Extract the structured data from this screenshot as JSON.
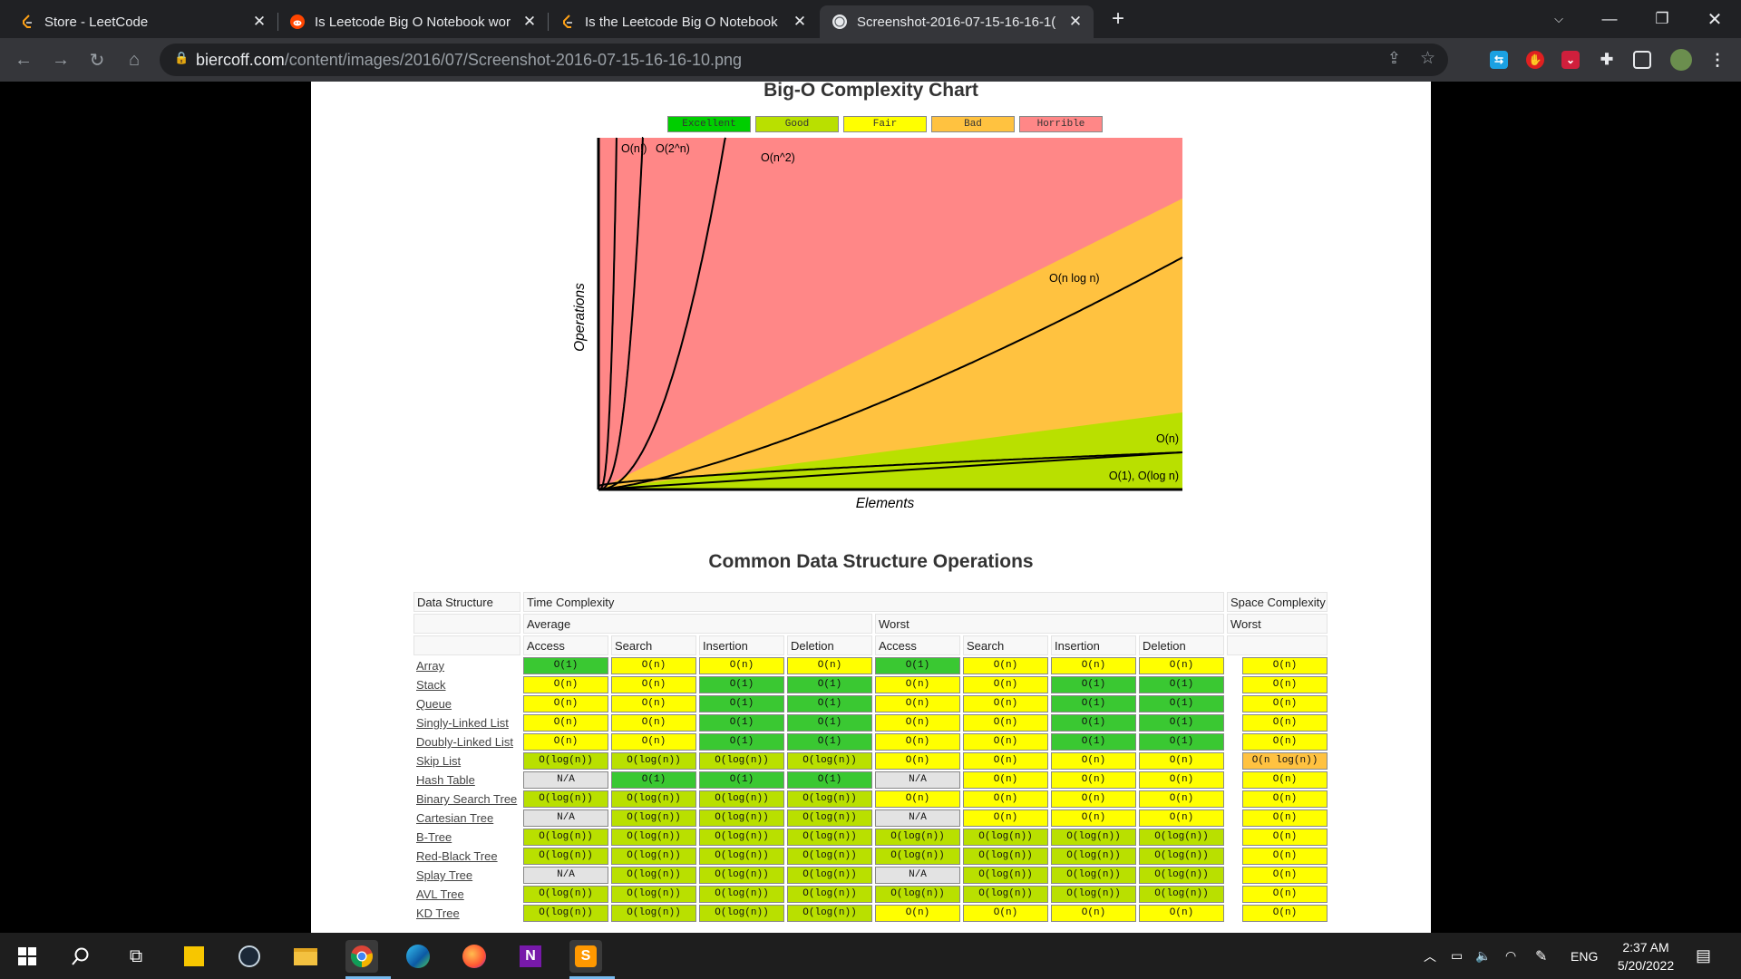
{
  "browser": {
    "tabs": [
      {
        "title": "Store - LeetCode",
        "icon": "leetcode-icon",
        "active": false
      },
      {
        "title": "Is Leetcode Big O Notebook wor",
        "icon": "reddit-icon",
        "active": false
      },
      {
        "title": "Is the Leetcode Big O Notebook",
        "icon": "leetcode-icon",
        "active": false
      },
      {
        "title": "Screenshot-2016-07-15-16-16-1(",
        "icon": "globe-icon",
        "active": true
      }
    ],
    "url_host": "biercoff.com",
    "url_path": "/content/images/2016/07/Screenshot-2016-07-15-16-16-10.png"
  },
  "chart_data": {
    "type": "area",
    "title": "Big-O Complexity Chart",
    "xlabel": "Elements",
    "ylabel": "Operations",
    "legend": [
      "Excellent",
      "Good",
      "Fair",
      "Bad",
      "Horrible"
    ],
    "legend_colors": [
      "#00ce00",
      "#b9e000",
      "#ffff00",
      "#ffc240",
      "#ff8787"
    ],
    "legend_placement": "top",
    "grid": false,
    "series": [
      {
        "name": "O(1), O(log n)"
      },
      {
        "name": "O(n)"
      },
      {
        "name": "O(n log n)"
      },
      {
        "name": "O(n^2)"
      },
      {
        "name": "O(2^n)"
      },
      {
        "name": "O(n!)"
      }
    ]
  },
  "table": {
    "title": "Common Data Structure Operations",
    "header1": {
      "structure": "Data Structure",
      "time": "Time Complexity",
      "space": "Space Complexity"
    },
    "header2": {
      "average": "Average",
      "worst": "Worst",
      "space_worst": "Worst"
    },
    "columns": [
      "Access",
      "Search",
      "Insertion",
      "Deletion",
      "Access",
      "Search",
      "Insertion",
      "Deletion"
    ],
    "rows": [
      {
        "name": "Array",
        "cells": [
          "O(1)",
          "O(n)",
          "O(n)",
          "O(n)",
          "O(1)",
          "O(n)",
          "O(n)",
          "O(n)",
          "O(n)"
        ],
        "ratings": [
          "excellent",
          "fair",
          "fair",
          "fair",
          "excellent",
          "fair",
          "fair",
          "fair",
          "fair"
        ]
      },
      {
        "name": "Stack",
        "cells": [
          "O(n)",
          "O(n)",
          "O(1)",
          "O(1)",
          "O(n)",
          "O(n)",
          "O(1)",
          "O(1)",
          "O(n)"
        ],
        "ratings": [
          "fair",
          "fair",
          "excellent",
          "excellent",
          "fair",
          "fair",
          "excellent",
          "excellent",
          "fair"
        ]
      },
      {
        "name": "Queue",
        "cells": [
          "O(n)",
          "O(n)",
          "O(1)",
          "O(1)",
          "O(n)",
          "O(n)",
          "O(1)",
          "O(1)",
          "O(n)"
        ],
        "ratings": [
          "fair",
          "fair",
          "excellent",
          "excellent",
          "fair",
          "fair",
          "excellent",
          "excellent",
          "fair"
        ]
      },
      {
        "name": "Singly-Linked List",
        "cells": [
          "O(n)",
          "O(n)",
          "O(1)",
          "O(1)",
          "O(n)",
          "O(n)",
          "O(1)",
          "O(1)",
          "O(n)"
        ],
        "ratings": [
          "fair",
          "fair",
          "excellent",
          "excellent",
          "fair",
          "fair",
          "excellent",
          "excellent",
          "fair"
        ]
      },
      {
        "name": "Doubly-Linked List",
        "cells": [
          "O(n)",
          "O(n)",
          "O(1)",
          "O(1)",
          "O(n)",
          "O(n)",
          "O(1)",
          "O(1)",
          "O(n)"
        ],
        "ratings": [
          "fair",
          "fair",
          "excellent",
          "excellent",
          "fair",
          "fair",
          "excellent",
          "excellent",
          "fair"
        ]
      },
      {
        "name": "Skip List",
        "cells": [
          "O(log(n))",
          "O(log(n))",
          "O(log(n))",
          "O(log(n))",
          "O(n)",
          "O(n)",
          "O(n)",
          "O(n)",
          "O(n log(n))"
        ],
        "ratings": [
          "good",
          "good",
          "good",
          "good",
          "fair",
          "fair",
          "fair",
          "fair",
          "bad"
        ]
      },
      {
        "name": "Hash Table",
        "cells": [
          "N/A",
          "O(1)",
          "O(1)",
          "O(1)",
          "N/A",
          "O(n)",
          "O(n)",
          "O(n)",
          "O(n)"
        ],
        "ratings": [
          "na",
          "excellent",
          "excellent",
          "excellent",
          "na",
          "fair",
          "fair",
          "fair",
          "fair"
        ]
      },
      {
        "name": "Binary Search Tree",
        "cells": [
          "O(log(n))",
          "O(log(n))",
          "O(log(n))",
          "O(log(n))",
          "O(n)",
          "O(n)",
          "O(n)",
          "O(n)",
          "O(n)"
        ],
        "ratings": [
          "good",
          "good",
          "good",
          "good",
          "fair",
          "fair",
          "fair",
          "fair",
          "fair"
        ]
      },
      {
        "name": "Cartesian Tree",
        "cells": [
          "N/A",
          "O(log(n))",
          "O(log(n))",
          "O(log(n))",
          "N/A",
          "O(n)",
          "O(n)",
          "O(n)",
          "O(n)"
        ],
        "ratings": [
          "na",
          "good",
          "good",
          "good",
          "na",
          "fair",
          "fair",
          "fair",
          "fair"
        ]
      },
      {
        "name": "B-Tree",
        "cells": [
          "O(log(n))",
          "O(log(n))",
          "O(log(n))",
          "O(log(n))",
          "O(log(n))",
          "O(log(n))",
          "O(log(n))",
          "O(log(n))",
          "O(n)"
        ],
        "ratings": [
          "good",
          "good",
          "good",
          "good",
          "good",
          "good",
          "good",
          "good",
          "fair"
        ]
      },
      {
        "name": "Red-Black Tree",
        "cells": [
          "O(log(n))",
          "O(log(n))",
          "O(log(n))",
          "O(log(n))",
          "O(log(n))",
          "O(log(n))",
          "O(log(n))",
          "O(log(n))",
          "O(n)"
        ],
        "ratings": [
          "good",
          "good",
          "good",
          "good",
          "good",
          "good",
          "good",
          "good",
          "fair"
        ]
      },
      {
        "name": "Splay Tree",
        "cells": [
          "N/A",
          "O(log(n))",
          "O(log(n))",
          "O(log(n))",
          "N/A",
          "O(log(n))",
          "O(log(n))",
          "O(log(n))",
          "O(n)"
        ],
        "ratings": [
          "na",
          "good",
          "good",
          "good",
          "na",
          "good",
          "good",
          "good",
          "fair"
        ]
      },
      {
        "name": "AVL Tree",
        "cells": [
          "O(log(n))",
          "O(log(n))",
          "O(log(n))",
          "O(log(n))",
          "O(log(n))",
          "O(log(n))",
          "O(log(n))",
          "O(log(n))",
          "O(n)"
        ],
        "ratings": [
          "good",
          "good",
          "good",
          "good",
          "good",
          "good",
          "good",
          "good",
          "fair"
        ]
      },
      {
        "name": "KD Tree",
        "cells": [
          "O(log(n))",
          "O(log(n))",
          "O(log(n))",
          "O(log(n))",
          "O(n)",
          "O(n)",
          "O(n)",
          "O(n)",
          "O(n)"
        ],
        "ratings": [
          "good",
          "good",
          "good",
          "good",
          "fair",
          "fair",
          "fair",
          "fair",
          "fair"
        ]
      }
    ],
    "rating_colors": {
      "excellent": "#3ac832",
      "good": "#b9e000",
      "fair": "#ffff00",
      "bad": "#ffc240",
      "horrible": "#ff8787",
      "na": "#e3e3e3"
    }
  },
  "taskbar": {
    "time": "2:37 AM",
    "date": "5/20/2022",
    "language": "ENG",
    "apps": [
      "windows-start-icon",
      "search-icon",
      "task-view-icon",
      "sticky-notes-icon",
      "steam-icon",
      "file-explorer-icon",
      "chrome-icon",
      "edge-icon",
      "firefox-icon",
      "onenote-icon",
      "sublime-text-icon"
    ]
  }
}
